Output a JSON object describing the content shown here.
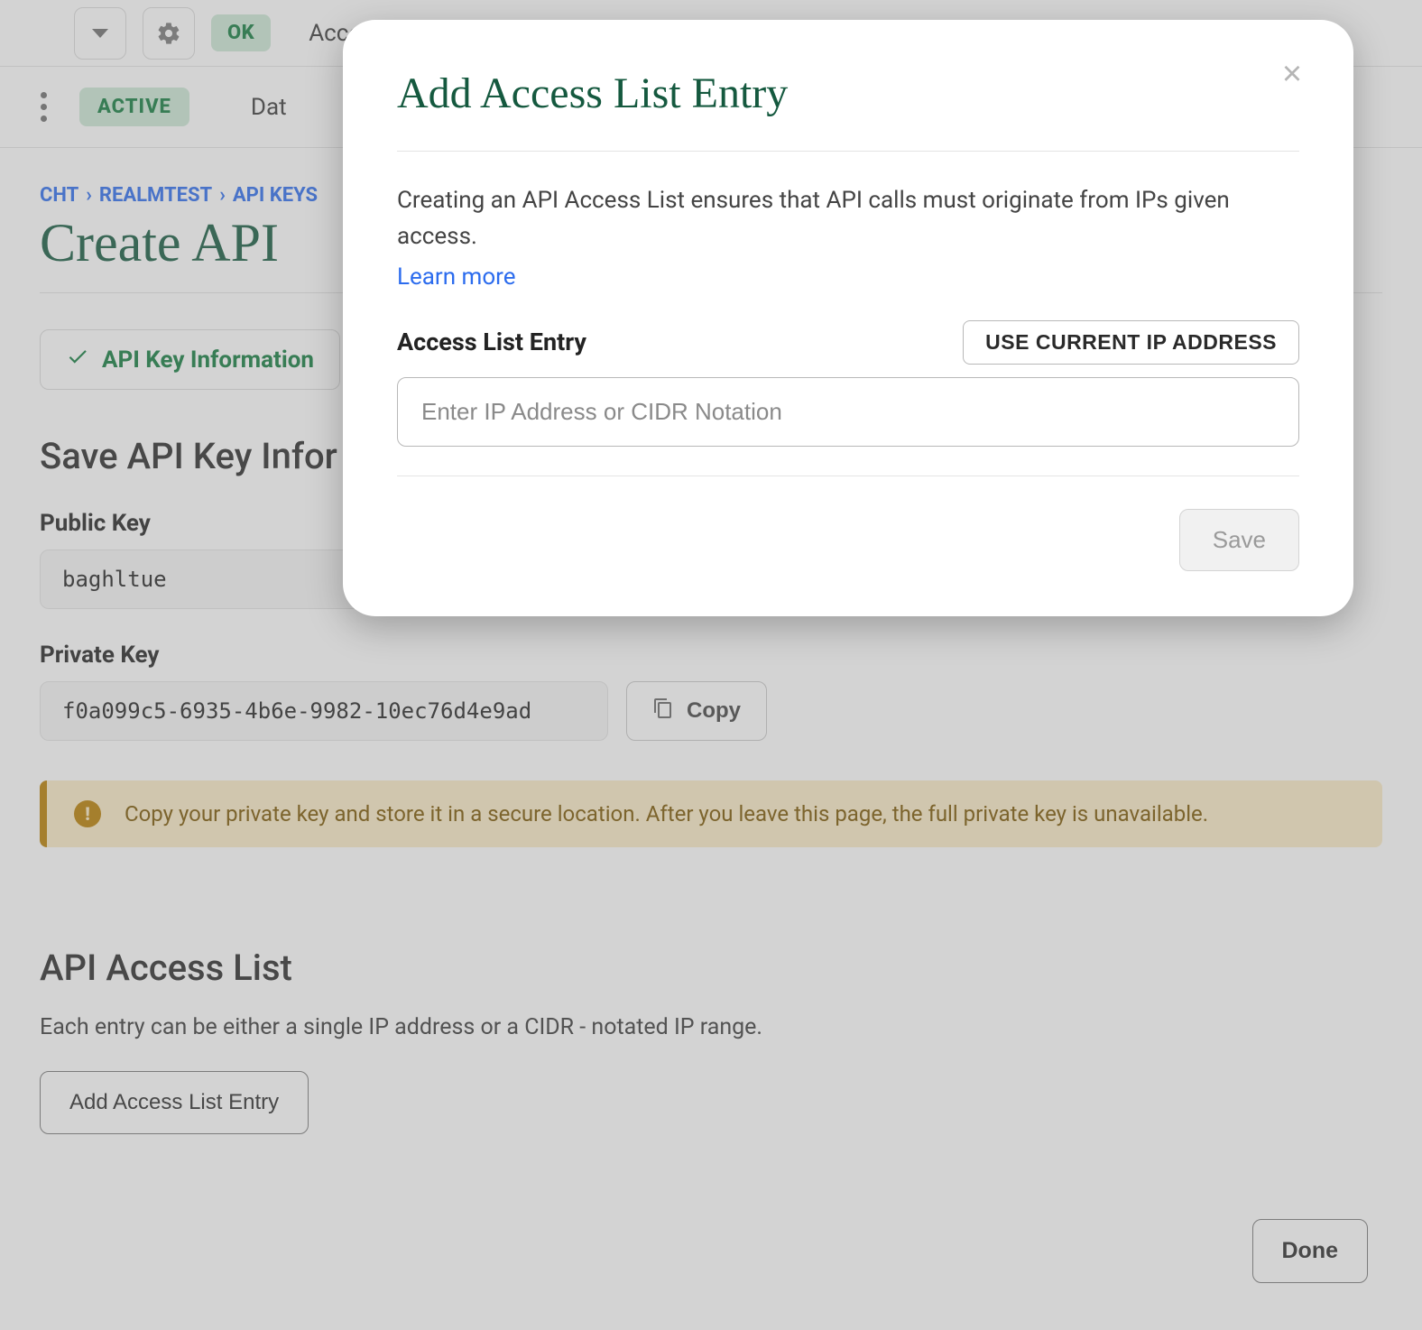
{
  "topbar": {
    "ok_badge": "OK",
    "nav_truncated": "Acce"
  },
  "subbar": {
    "active_badge": "ACTIVE",
    "nav_truncated": "Dat"
  },
  "breadcrumb": [
    {
      "label": "CHT"
    },
    {
      "label": "REALMTEST"
    },
    {
      "label": "API KEYS"
    }
  ],
  "page_title": "Create API",
  "section_pill": "API Key Information",
  "save_section_title": "Save API Key Infor",
  "public_key": {
    "label": "Public Key",
    "value": "baghltue"
  },
  "private_key": {
    "label": "Private Key",
    "value": "f0a099c5-6935-4b6e-9982-10ec76d4e9ad",
    "copy_label": "Copy"
  },
  "warn_text": "Copy your private key and store it in a secure location. After you leave this page, the full private key is unavailable.",
  "access_list": {
    "title": "API Access List",
    "desc": "Each entry can be either a single IP address or a CIDR - notated IP range.",
    "add_button": "Add Access List Entry"
  },
  "done_label": "Done",
  "modal": {
    "title": "Add Access List Entry",
    "desc": "Creating an API Access List ensures that API calls must originate from IPs given access.",
    "learn_more": "Learn more",
    "field_label": "Access List Entry",
    "use_current_ip": "USE CURRENT IP ADDRESS",
    "placeholder": "Enter IP Address or CIDR Notation",
    "save_label": "Save"
  }
}
